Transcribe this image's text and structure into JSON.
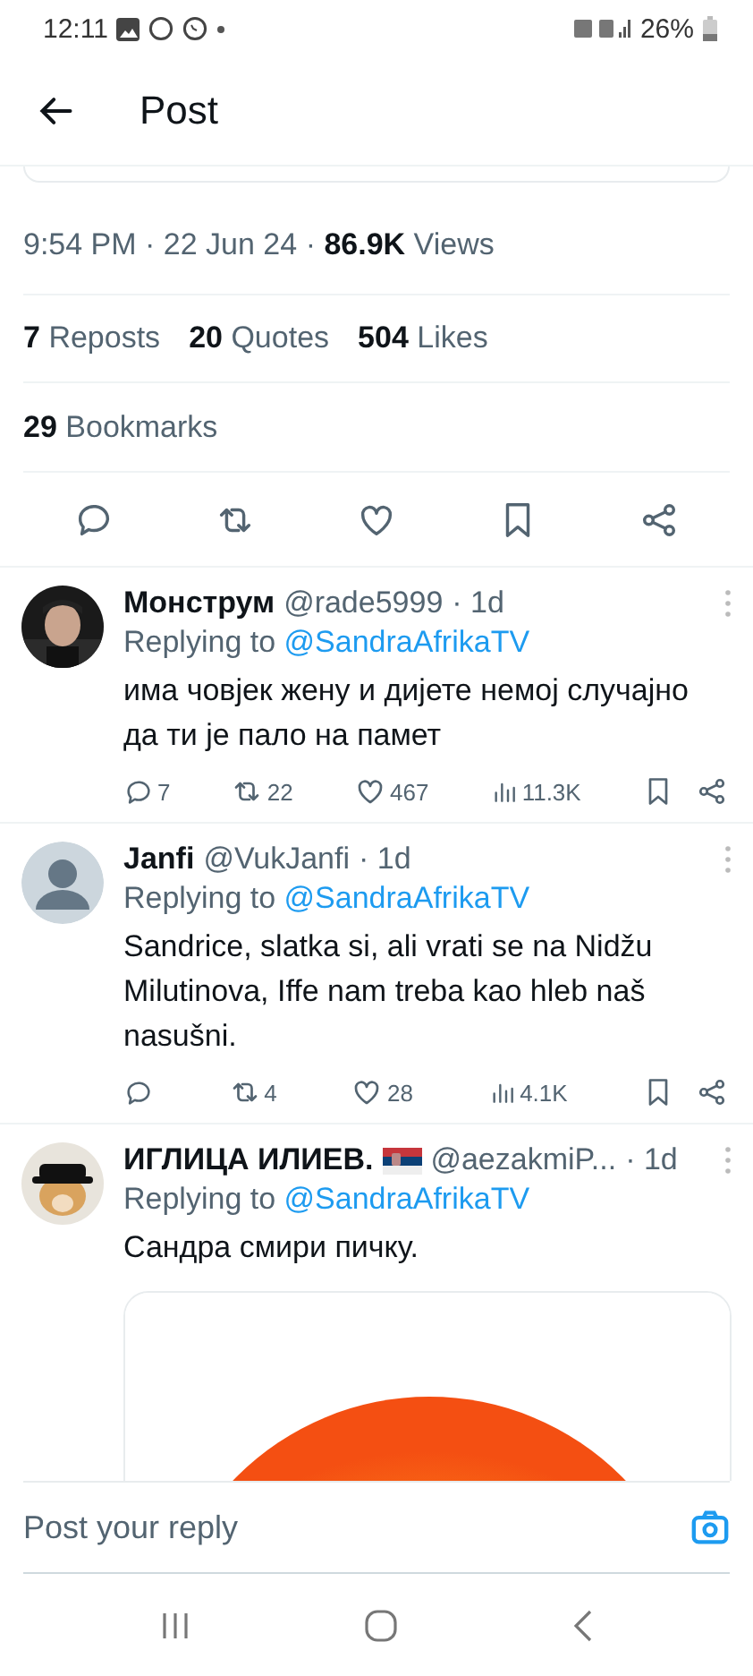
{
  "status_bar": {
    "time": "12:11",
    "battery": "26%"
  },
  "header": {
    "title": "Post"
  },
  "post_meta": {
    "timestamp": "9:54 PM · 22 Jun 24 · **86.9K** Views"
  },
  "engagement": [
    {
      "text": "**7** Reposts"
    },
    {
      "text": "**20** Quotes"
    },
    {
      "text": "**504** Likes"
    }
  ],
  "bookmarks": {
    "text": "**29** Bookmarks"
  },
  "replies": [
    {
      "name": "Монструм",
      "handle": "@rade5999",
      "time": "· 1d",
      "replying_label": "Replying to",
      "replying_to": "@SandraAfrikaTV",
      "text": "има човјек жену и дијете немој случајно да ти је пало на памет",
      "replies": "7",
      "reposts": "22",
      "likes": "467",
      "views": "11.3K"
    },
    {
      "avatar": {
        "kind": "default"
      },
      "name": "Janfi",
      "handle": "@VukJanfi",
      "time": "· 1d",
      "replying_label": "Replying to",
      "replying_to": "@SandraAfrikaTV",
      "text": "Sandrice, slatka si, ali vrati se na Nidžu Milutinova, Iffe nam treba kao hleb naš nasušni.",
      "reposts": "4",
      "likes": "28",
      "views": "4.1K"
    },
    {
      "name": "ИГЛИЦА ИЛИЕВ.",
      "flag": true,
      "handle": "@aezakmiP...",
      "time": "· 1d",
      "replying_label": "Replying to",
      "replying_to": "@SandraAfrikaTV",
      "text": "Сандра смири пичку."
    }
  ],
  "reply_box": {
    "placeholder": "Post your reply"
  }
}
